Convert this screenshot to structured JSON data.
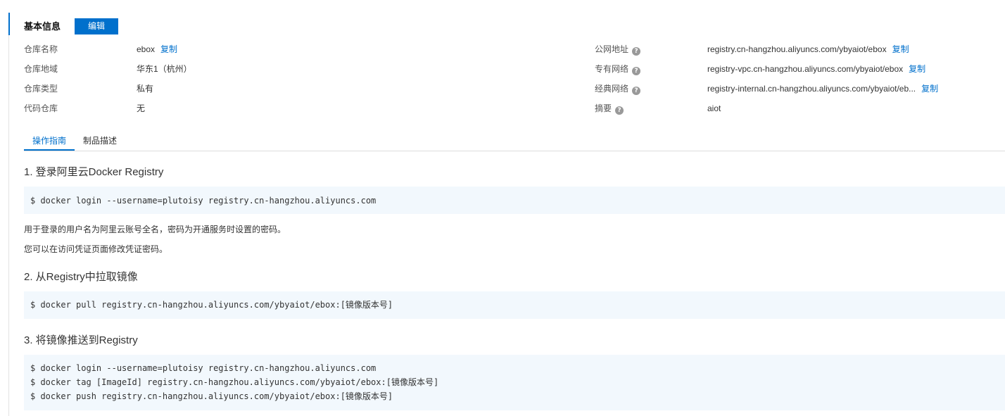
{
  "basic_info": {
    "title": "基本信息",
    "edit_label": "编辑",
    "copy_label": "复制",
    "left_fields": [
      {
        "label": "仓库名称",
        "value": "ebox"
      },
      {
        "label": "仓库地域",
        "value": "华东1（杭州）"
      },
      {
        "label": "仓库类型",
        "value": "私有"
      },
      {
        "label": "代码仓库",
        "value": "无"
      }
    ],
    "right_fields": [
      {
        "label": "公网地址",
        "value": "registry.cn-hangzhou.aliyuncs.com/ybyaiot/ebox"
      },
      {
        "label": "专有网络",
        "value": "registry-vpc.cn-hangzhou.aliyuncs.com/ybyaiot/ebox"
      },
      {
        "label": "经典网络",
        "value": "registry-internal.cn-hangzhou.aliyuncs.com/ybyaiot/eb..."
      },
      {
        "label": "摘要",
        "value": "aiot"
      }
    ],
    "help_glyph": "?"
  },
  "tabs": [
    {
      "label": "操作指南",
      "active": true
    },
    {
      "label": "制品描述",
      "active": false
    }
  ],
  "guide": {
    "step1": {
      "heading": "1. 登录阿里云Docker Registry",
      "code": [
        "$ docker login --username=plutoisy registry.cn-hangzhou.aliyuncs.com"
      ],
      "notes": [
        "用于登录的用户名为阿里云账号全名，密码为开通服务时设置的密码。",
        "您可以在访问凭证页面修改凭证密码。"
      ]
    },
    "step2": {
      "heading": "2. 从Registry中拉取镜像",
      "code": [
        "$ docker pull registry.cn-hangzhou.aliyuncs.com/ybyaiot/ebox:[镜像版本号]"
      ]
    },
    "step3": {
      "heading": "3. 将镜像推送到Registry",
      "code": [
        "$ docker login --username=plutoisy registry.cn-hangzhou.aliyuncs.com",
        "$ docker tag [ImageId] registry.cn-hangzhou.aliyuncs.com/ybyaiot/ebox:[镜像版本号]",
        "$ docker push registry.cn-hangzhou.aliyuncs.com/ybyaiot/ebox:[镜像版本号]"
      ]
    }
  },
  "colors": {
    "accent": "#0070cc",
    "code_background": "#f2f8fd",
    "help_icon": "#999999"
  }
}
